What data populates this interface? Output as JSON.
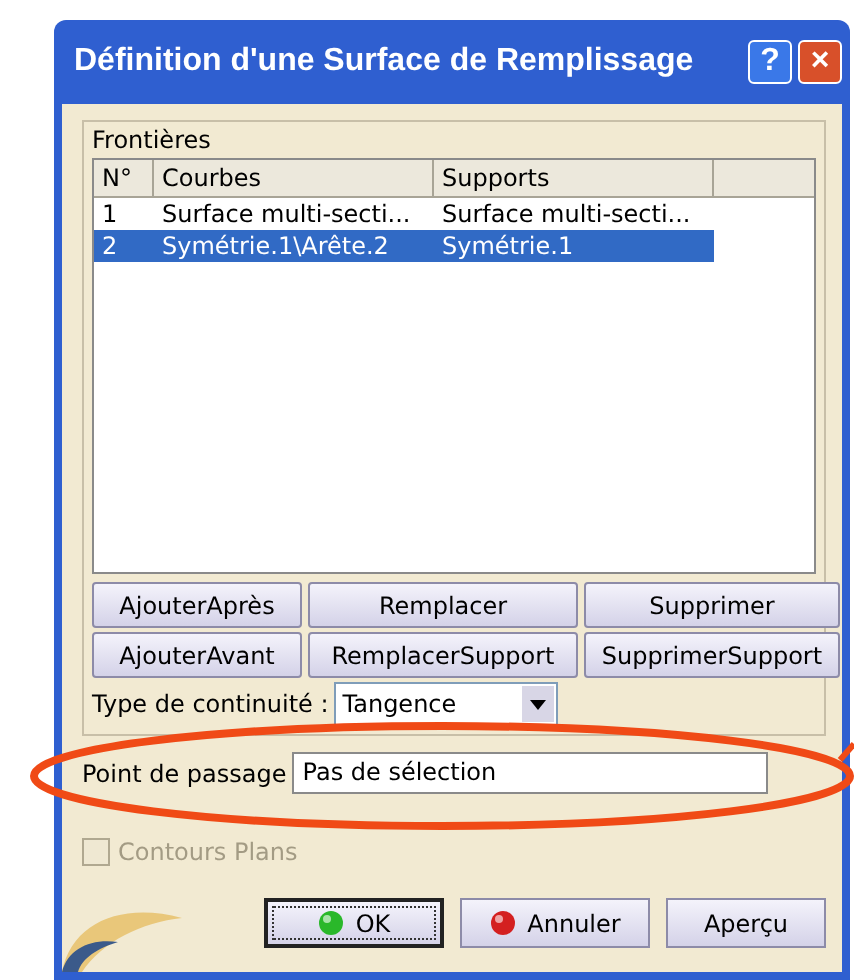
{
  "window": {
    "title": "Définition d'une Surface de Remplissage",
    "help": "?",
    "close": "×"
  },
  "group": {
    "label": "Frontières",
    "columns": [
      "N°",
      "Courbes",
      "Supports"
    ],
    "rows": [
      {
        "cells": [
          "1",
          "Surface multi-secti...",
          "Surface multi-secti..."
        ],
        "selected": false
      },
      {
        "cells": [
          "2",
          "Symétrie.1\\Arête.2",
          "Symétrie.1"
        ],
        "selected": true
      }
    ],
    "button_rows": [
      [
        "AjouterAprès",
        "Remplacer",
        "Supprimer"
      ],
      [
        "AjouterAvant",
        "RemplacerSupport",
        "SupprimerSupport"
      ]
    ],
    "continuity": {
      "label": "Type de continuité :",
      "value": "Tangence"
    }
  },
  "passage": {
    "label": "Point de passage",
    "value": "Pas de sélection"
  },
  "checkbox": {
    "label": "Contours Plans",
    "checked": false,
    "disabled": true
  },
  "buttons": [
    {
      "label": "OK",
      "kind": "ok",
      "default": true
    },
    {
      "label": "Annuler",
      "kind": "cancel",
      "default": false
    },
    {
      "label": "Aperçu",
      "kind": "plain",
      "default": false
    }
  ]
}
